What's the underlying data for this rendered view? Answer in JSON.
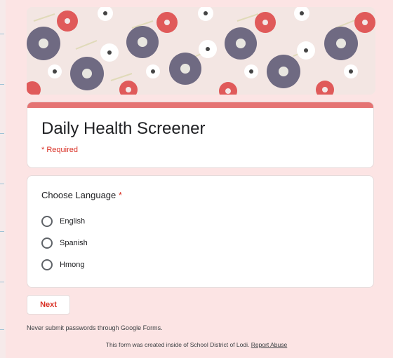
{
  "form": {
    "title": "Daily Health Screener",
    "required_note": "* Required",
    "accent_color": "#e57373",
    "background_color": "#fce4e4"
  },
  "question": {
    "label": "Choose Language",
    "required_mark": "*",
    "options": [
      {
        "label": "English",
        "selected": false
      },
      {
        "label": "Spanish",
        "selected": false
      },
      {
        "label": "Hmong",
        "selected": false
      }
    ]
  },
  "actions": {
    "next_label": "Next"
  },
  "footer": {
    "note": "Never submit passwords through Google Forms.",
    "created_text": "This form was created inside of School District of Lodi.",
    "report_link": "Report Abuse"
  }
}
